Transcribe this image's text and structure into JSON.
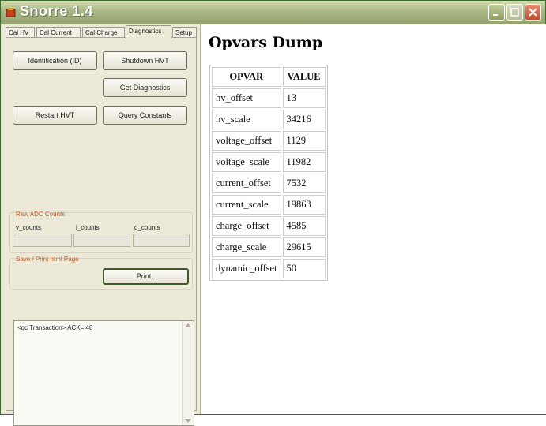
{
  "window": {
    "title": "Snorre 1.4"
  },
  "tabs": [
    "Cal HV",
    "Cal Current",
    "Cal Charge",
    "Diagnostics",
    "Setup"
  ],
  "active_tab": "Diagnostics",
  "buttons": {
    "identification": "Identification (ID)",
    "shutdown": "Shutdown HVT",
    "get_diagnostics": "Get Diagnostics",
    "restart": "Restart HVT",
    "query_constants": "Query Constants",
    "print": "Print.."
  },
  "raw_adc": {
    "group_label": "Raw ADC Counts",
    "v_label": "v_counts",
    "i_label": "i_counts",
    "q_label": "q_counts",
    "v_value": "",
    "i_value": "",
    "q_value": ""
  },
  "save_print": {
    "group_label": "Save / Print html Page"
  },
  "log": {
    "text": "<qc Transaction> ACK= 48"
  },
  "dump": {
    "heading": "Opvars Dump",
    "columns": [
      "OPVAR",
      "VALUE"
    ],
    "rows": [
      [
        "hv_offset",
        "13"
      ],
      [
        "hv_scale",
        "34216"
      ],
      [
        "voltage_offset",
        "1129"
      ],
      [
        "voltage_scale",
        "11982"
      ],
      [
        "current_offset",
        "7532"
      ],
      [
        "current_scale",
        "19863"
      ],
      [
        "charge_offset",
        "4585"
      ],
      [
        "charge_scale",
        "29615"
      ],
      [
        "dynamic_offset",
        "50"
      ]
    ]
  },
  "colors": {
    "group_label": "#c0642a",
    "titlebar": "#a9b685",
    "close_button": "#c24a2c"
  }
}
